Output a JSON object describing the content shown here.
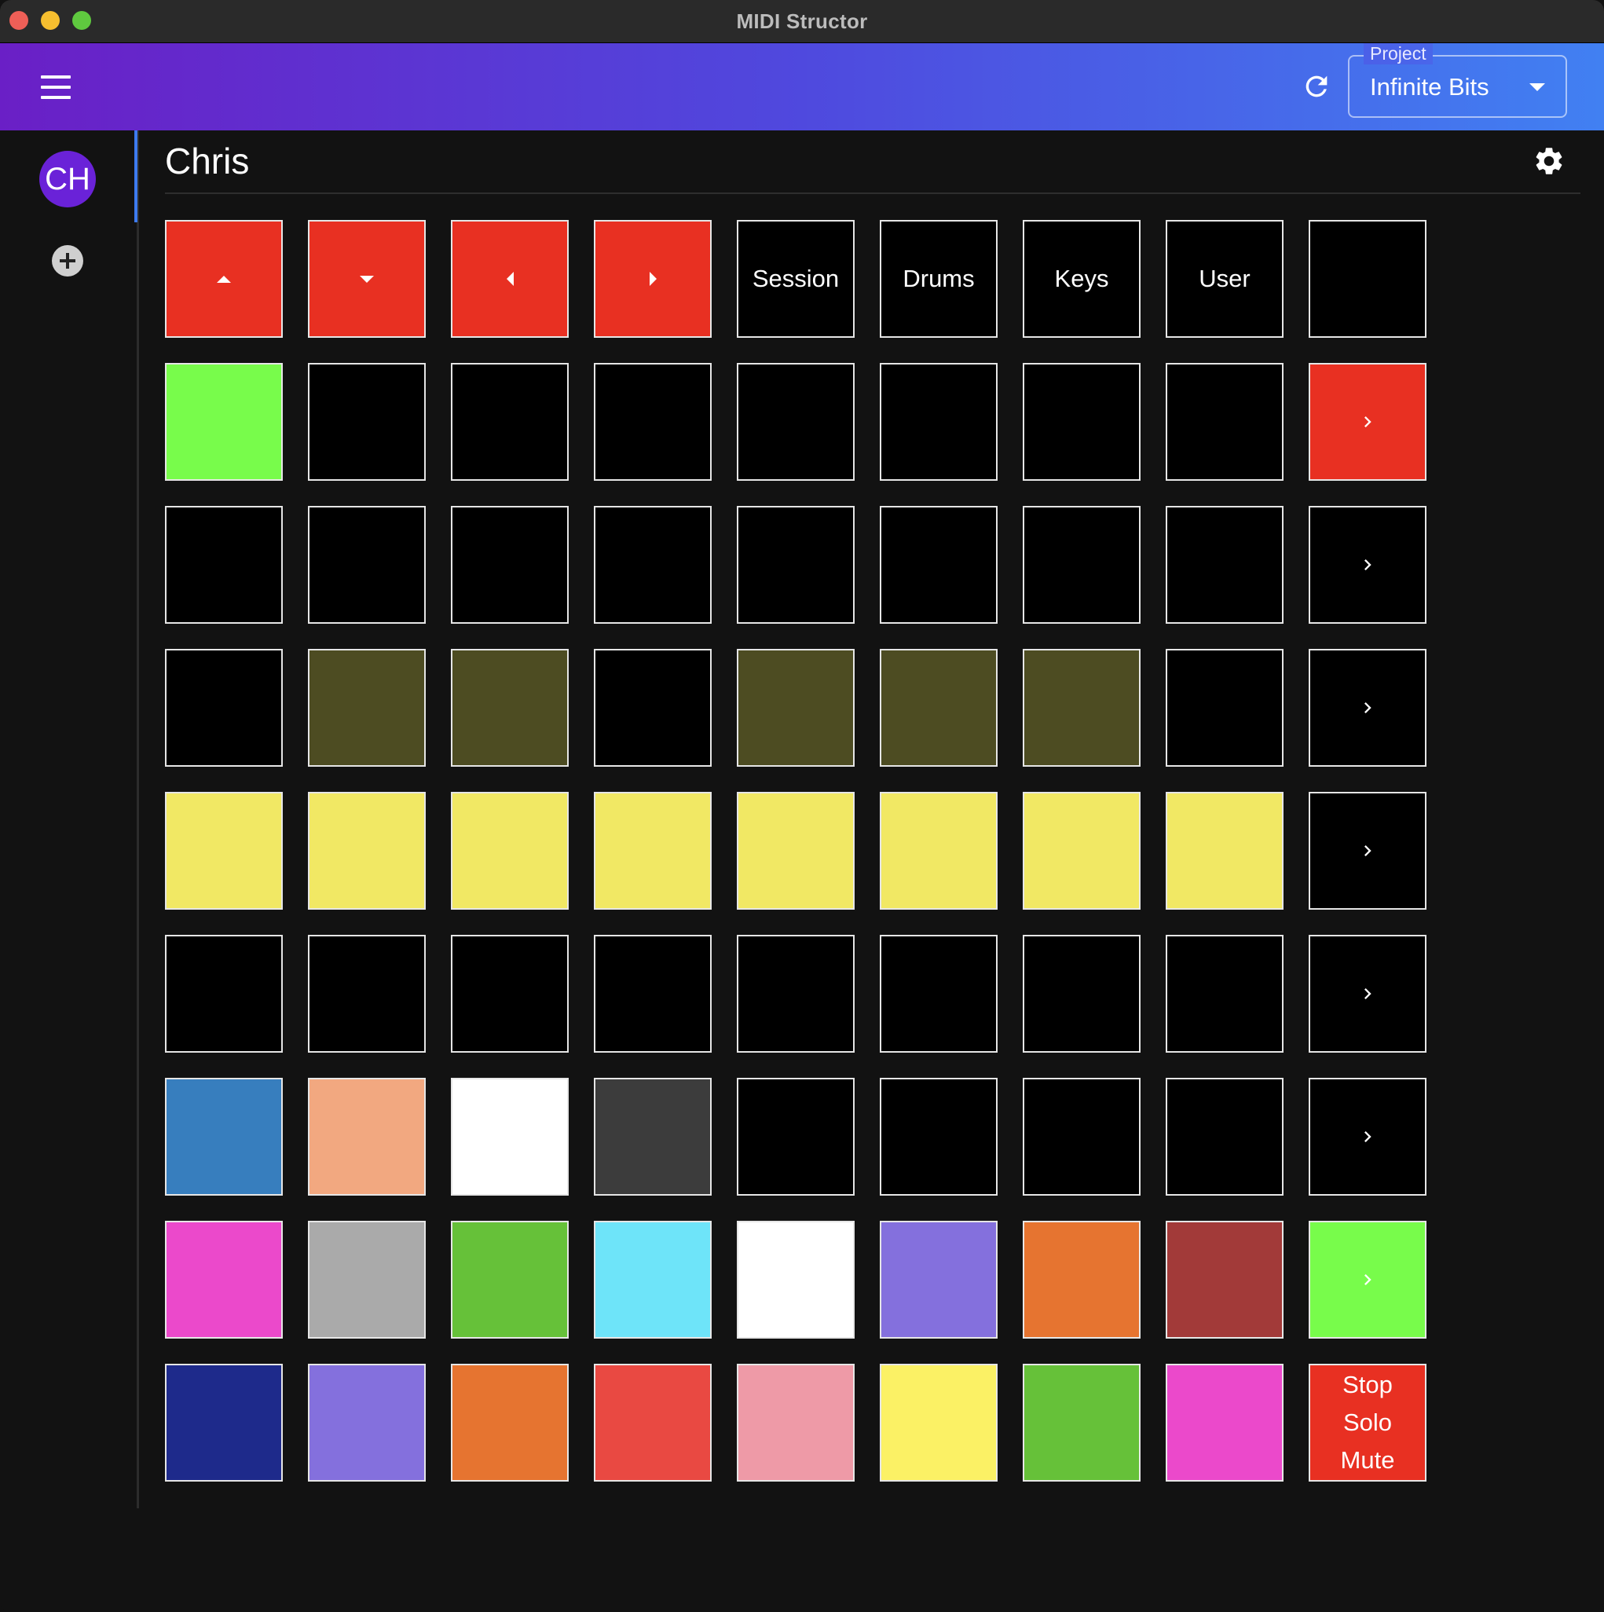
{
  "window": {
    "title": "MIDI Structor"
  },
  "appbar": {
    "project_label": "Project",
    "project_value": "Infinite Bits",
    "gradient": [
      "#6a1fc6",
      "#4180f2"
    ]
  },
  "sidebar": {
    "avatar_initials": "CH",
    "avatar_color": "#6a22d8"
  },
  "page": {
    "title": "Chris"
  },
  "pads": [
    [
      {
        "color": "#e83022",
        "icon": "up"
      },
      {
        "color": "#e83022",
        "icon": "down"
      },
      {
        "color": "#e83022",
        "icon": "left"
      },
      {
        "color": "#e83022",
        "icon": "right"
      },
      {
        "color": "#000000",
        "label": "Session"
      },
      {
        "color": "#000000",
        "label": "Drums"
      },
      {
        "color": "#000000",
        "label": "Keys"
      },
      {
        "color": "#000000",
        "label": "User"
      },
      {
        "color": "#000000"
      }
    ],
    [
      {
        "color": "#78fc4b"
      },
      {
        "color": "#000000"
      },
      {
        "color": "#000000"
      },
      {
        "color": "#000000"
      },
      {
        "color": "#000000"
      },
      {
        "color": "#000000"
      },
      {
        "color": "#000000"
      },
      {
        "color": "#000000"
      },
      {
        "color": "#e83022",
        "icon": "chevron"
      }
    ],
    [
      {
        "color": "#000000"
      },
      {
        "color": "#000000"
      },
      {
        "color": "#000000"
      },
      {
        "color": "#000000"
      },
      {
        "color": "#000000"
      },
      {
        "color": "#000000"
      },
      {
        "color": "#000000"
      },
      {
        "color": "#000000"
      },
      {
        "color": "#000000",
        "icon": "chevron"
      }
    ],
    [
      {
        "color": "#000000"
      },
      {
        "color": "#4d4c22"
      },
      {
        "color": "#4d4c22"
      },
      {
        "color": "#000000"
      },
      {
        "color": "#4d4c22"
      },
      {
        "color": "#4d4c22"
      },
      {
        "color": "#4d4c22"
      },
      {
        "color": "#000000"
      },
      {
        "color": "#000000",
        "icon": "chevron"
      }
    ],
    [
      {
        "color": "#f1e864"
      },
      {
        "color": "#f1e864"
      },
      {
        "color": "#f1e864"
      },
      {
        "color": "#f1e864"
      },
      {
        "color": "#f1e864"
      },
      {
        "color": "#f1e864"
      },
      {
        "color": "#f1e864"
      },
      {
        "color": "#f1e864"
      },
      {
        "color": "#000000",
        "icon": "chevron"
      }
    ],
    [
      {
        "color": "#000000"
      },
      {
        "color": "#000000"
      },
      {
        "color": "#000000"
      },
      {
        "color": "#000000"
      },
      {
        "color": "#000000"
      },
      {
        "color": "#000000"
      },
      {
        "color": "#000000"
      },
      {
        "color": "#000000"
      },
      {
        "color": "#000000",
        "icon": "chevron"
      }
    ],
    [
      {
        "color": "#377ebe"
      },
      {
        "color": "#f2a880"
      },
      {
        "color": "#ffffff"
      },
      {
        "color": "#3c3c3c"
      },
      {
        "color": "#000000"
      },
      {
        "color": "#000000"
      },
      {
        "color": "#000000"
      },
      {
        "color": "#000000"
      },
      {
        "color": "#000000",
        "icon": "chevron"
      }
    ],
    [
      {
        "color": "#eb49cb"
      },
      {
        "color": "#aaaaaa"
      },
      {
        "color": "#66c139"
      },
      {
        "color": "#6ee4f9"
      },
      {
        "color": "#ffffff"
      },
      {
        "color": "#8470dd"
      },
      {
        "color": "#e67430"
      },
      {
        "color": "#a23a39"
      },
      {
        "color": "#78fc4b",
        "icon": "chevron"
      }
    ],
    [
      {
        "color": "#1e2a8b"
      },
      {
        "color": "#8470dd"
      },
      {
        "color": "#e67430"
      },
      {
        "color": "#e94942"
      },
      {
        "color": "#ee9aa7"
      },
      {
        "color": "#fbf165"
      },
      {
        "color": "#66c139"
      },
      {
        "color": "#eb49cb"
      },
      {
        "color": "#e83022",
        "label": "Stop\nSolo\nMute"
      }
    ]
  ]
}
